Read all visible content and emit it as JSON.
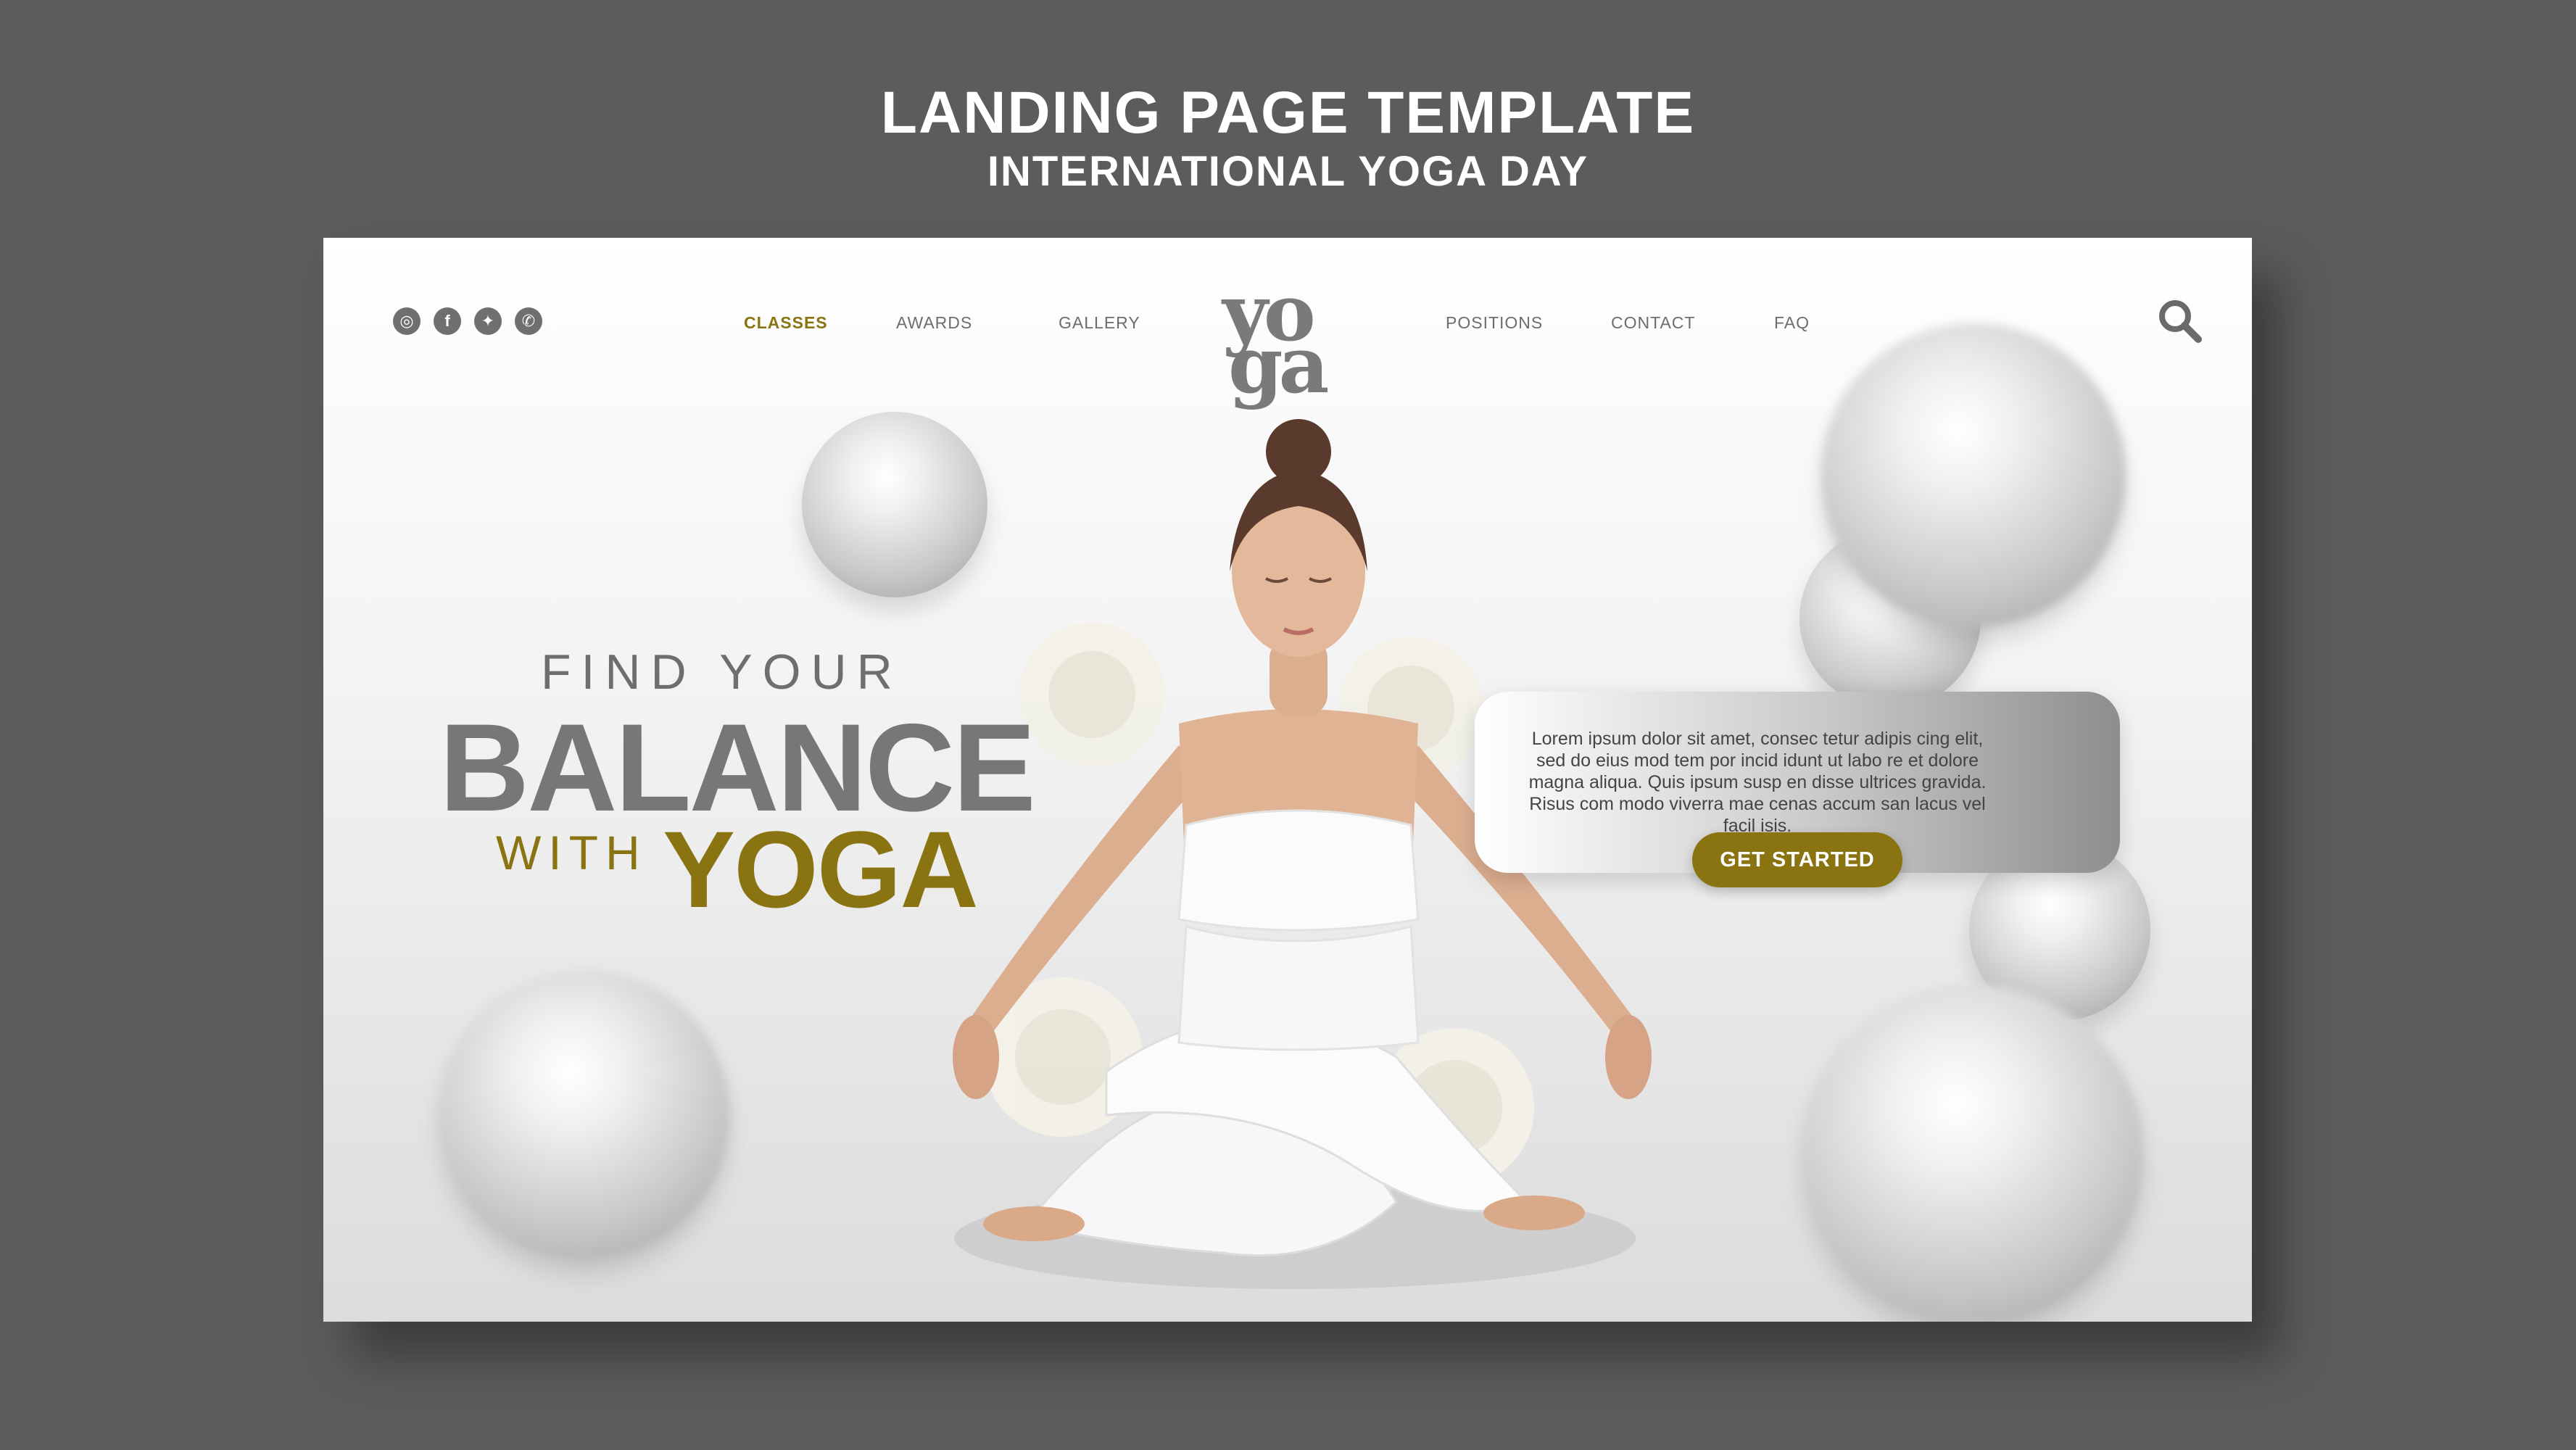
{
  "header": {
    "title": "LANDING PAGE TEMPLATE",
    "subtitle": "INTERNATIONAL YOGA DAY"
  },
  "nav": {
    "socials": [
      {
        "icon": "instagram-icon",
        "glyph": "◎"
      },
      {
        "icon": "facebook-icon",
        "glyph": "f"
      },
      {
        "icon": "twitter-icon",
        "glyph": "✦"
      },
      {
        "icon": "whatsapp-icon",
        "glyph": "✆"
      }
    ],
    "items": [
      "CLASSES",
      "AWARDS",
      "GALLERY",
      "POSITIONS",
      "CONTACT",
      "FAQ"
    ],
    "active": "CLASSES",
    "logo_row1": "yo",
    "logo_row2": "ga"
  },
  "hero": {
    "line1": "FIND YOUR",
    "line2": "BALANCE",
    "line3a": "WITH",
    "line3b": "YOGA"
  },
  "info": {
    "text": "Lorem ipsum dolor sit amet, consec tetur adipis cing elit, sed do eius mod tem por incid idunt ut labo re et dolore magna aliqua. Quis ipsum susp en disse ultrices gravida. Risus com modo viverra mae cenas accum san lacus vel facil isis.",
    "cta": "GET STARTED"
  },
  "colors": {
    "background": "#5c5c5c",
    "accent": "#8a7412",
    "heading_gray": "#777777"
  }
}
